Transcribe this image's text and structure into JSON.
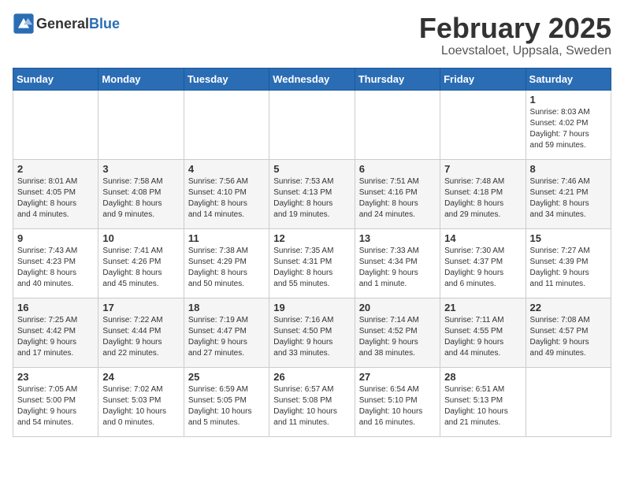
{
  "header": {
    "logo_general": "General",
    "logo_blue": "Blue",
    "month": "February 2025",
    "location": "Loevstaloet, Uppsala, Sweden"
  },
  "weekdays": [
    "Sunday",
    "Monday",
    "Tuesday",
    "Wednesday",
    "Thursday",
    "Friday",
    "Saturday"
  ],
  "weeks": [
    [
      {
        "day": "",
        "info": ""
      },
      {
        "day": "",
        "info": ""
      },
      {
        "day": "",
        "info": ""
      },
      {
        "day": "",
        "info": ""
      },
      {
        "day": "",
        "info": ""
      },
      {
        "day": "",
        "info": ""
      },
      {
        "day": "1",
        "info": "Sunrise: 8:03 AM\nSunset: 4:02 PM\nDaylight: 7 hours\nand 59 minutes."
      }
    ],
    [
      {
        "day": "2",
        "info": "Sunrise: 8:01 AM\nSunset: 4:05 PM\nDaylight: 8 hours\nand 4 minutes."
      },
      {
        "day": "3",
        "info": "Sunrise: 7:58 AM\nSunset: 4:08 PM\nDaylight: 8 hours\nand 9 minutes."
      },
      {
        "day": "4",
        "info": "Sunrise: 7:56 AM\nSunset: 4:10 PM\nDaylight: 8 hours\nand 14 minutes."
      },
      {
        "day": "5",
        "info": "Sunrise: 7:53 AM\nSunset: 4:13 PM\nDaylight: 8 hours\nand 19 minutes."
      },
      {
        "day": "6",
        "info": "Sunrise: 7:51 AM\nSunset: 4:16 PM\nDaylight: 8 hours\nand 24 minutes."
      },
      {
        "day": "7",
        "info": "Sunrise: 7:48 AM\nSunset: 4:18 PM\nDaylight: 8 hours\nand 29 minutes."
      },
      {
        "day": "8",
        "info": "Sunrise: 7:46 AM\nSunset: 4:21 PM\nDaylight: 8 hours\nand 34 minutes."
      }
    ],
    [
      {
        "day": "9",
        "info": "Sunrise: 7:43 AM\nSunset: 4:23 PM\nDaylight: 8 hours\nand 40 minutes."
      },
      {
        "day": "10",
        "info": "Sunrise: 7:41 AM\nSunset: 4:26 PM\nDaylight: 8 hours\nand 45 minutes."
      },
      {
        "day": "11",
        "info": "Sunrise: 7:38 AM\nSunset: 4:29 PM\nDaylight: 8 hours\nand 50 minutes."
      },
      {
        "day": "12",
        "info": "Sunrise: 7:35 AM\nSunset: 4:31 PM\nDaylight: 8 hours\nand 55 minutes."
      },
      {
        "day": "13",
        "info": "Sunrise: 7:33 AM\nSunset: 4:34 PM\nDaylight: 9 hours\nand 1 minute."
      },
      {
        "day": "14",
        "info": "Sunrise: 7:30 AM\nSunset: 4:37 PM\nDaylight: 9 hours\nand 6 minutes."
      },
      {
        "day": "15",
        "info": "Sunrise: 7:27 AM\nSunset: 4:39 PM\nDaylight: 9 hours\nand 11 minutes."
      }
    ],
    [
      {
        "day": "16",
        "info": "Sunrise: 7:25 AM\nSunset: 4:42 PM\nDaylight: 9 hours\nand 17 minutes."
      },
      {
        "day": "17",
        "info": "Sunrise: 7:22 AM\nSunset: 4:44 PM\nDaylight: 9 hours\nand 22 minutes."
      },
      {
        "day": "18",
        "info": "Sunrise: 7:19 AM\nSunset: 4:47 PM\nDaylight: 9 hours\nand 27 minutes."
      },
      {
        "day": "19",
        "info": "Sunrise: 7:16 AM\nSunset: 4:50 PM\nDaylight: 9 hours\nand 33 minutes."
      },
      {
        "day": "20",
        "info": "Sunrise: 7:14 AM\nSunset: 4:52 PM\nDaylight: 9 hours\nand 38 minutes."
      },
      {
        "day": "21",
        "info": "Sunrise: 7:11 AM\nSunset: 4:55 PM\nDaylight: 9 hours\nand 44 minutes."
      },
      {
        "day": "22",
        "info": "Sunrise: 7:08 AM\nSunset: 4:57 PM\nDaylight: 9 hours\nand 49 minutes."
      }
    ],
    [
      {
        "day": "23",
        "info": "Sunrise: 7:05 AM\nSunset: 5:00 PM\nDaylight: 9 hours\nand 54 minutes."
      },
      {
        "day": "24",
        "info": "Sunrise: 7:02 AM\nSunset: 5:03 PM\nDaylight: 10 hours\nand 0 minutes."
      },
      {
        "day": "25",
        "info": "Sunrise: 6:59 AM\nSunset: 5:05 PM\nDaylight: 10 hours\nand 5 minutes."
      },
      {
        "day": "26",
        "info": "Sunrise: 6:57 AM\nSunset: 5:08 PM\nDaylight: 10 hours\nand 11 minutes."
      },
      {
        "day": "27",
        "info": "Sunrise: 6:54 AM\nSunset: 5:10 PM\nDaylight: 10 hours\nand 16 minutes."
      },
      {
        "day": "28",
        "info": "Sunrise: 6:51 AM\nSunset: 5:13 PM\nDaylight: 10 hours\nand 21 minutes."
      },
      {
        "day": "",
        "info": ""
      }
    ]
  ]
}
